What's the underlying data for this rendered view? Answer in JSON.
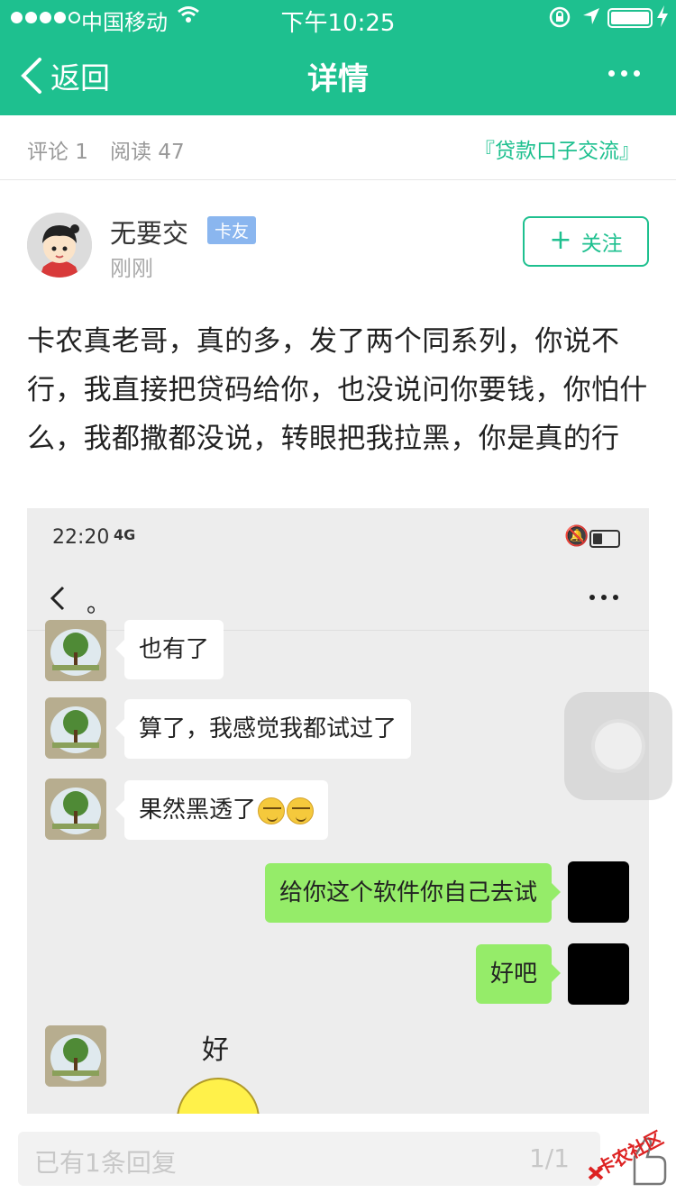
{
  "status_bar": {
    "carrier": "中国移动",
    "time": "下午10:25"
  },
  "nav": {
    "back_label": "返回",
    "title": "详情"
  },
  "stats": {
    "comments": "评论 1",
    "reads": "阅读 47",
    "topic": "『贷款口子交流』"
  },
  "author": {
    "name": "无要交",
    "badge": "卡友",
    "time": "刚刚",
    "follow_label": "关注"
  },
  "post": {
    "text": "卡农真老哥，真的多，发了两个同系列，你说不行，我直接把贷码给你，也没说问你要钱，你怕什么，我都撒都没说，转眼把我拉黑，你是真的行"
  },
  "screenshot": {
    "time": "22:20",
    "network": "4G",
    "chat_title": "。",
    "messages": [
      {
        "side": "in",
        "text": "也有了"
      },
      {
        "side": "in",
        "text": "算了，我感觉我都试过了"
      },
      {
        "side": "in",
        "text": "果然黑透了"
      },
      {
        "side": "out",
        "text": "给你这个软件你自己去试"
      },
      {
        "side": "out",
        "text": "好吧"
      },
      {
        "side": "in",
        "text": "好"
      }
    ]
  },
  "reply": {
    "placeholder": "已有1条回复",
    "page": "1/1"
  },
  "watermark": "卡农社区",
  "colors": {
    "brand": "#1ec08f",
    "badge": "#8ab6ef",
    "bubble_out": "#95ec69"
  }
}
